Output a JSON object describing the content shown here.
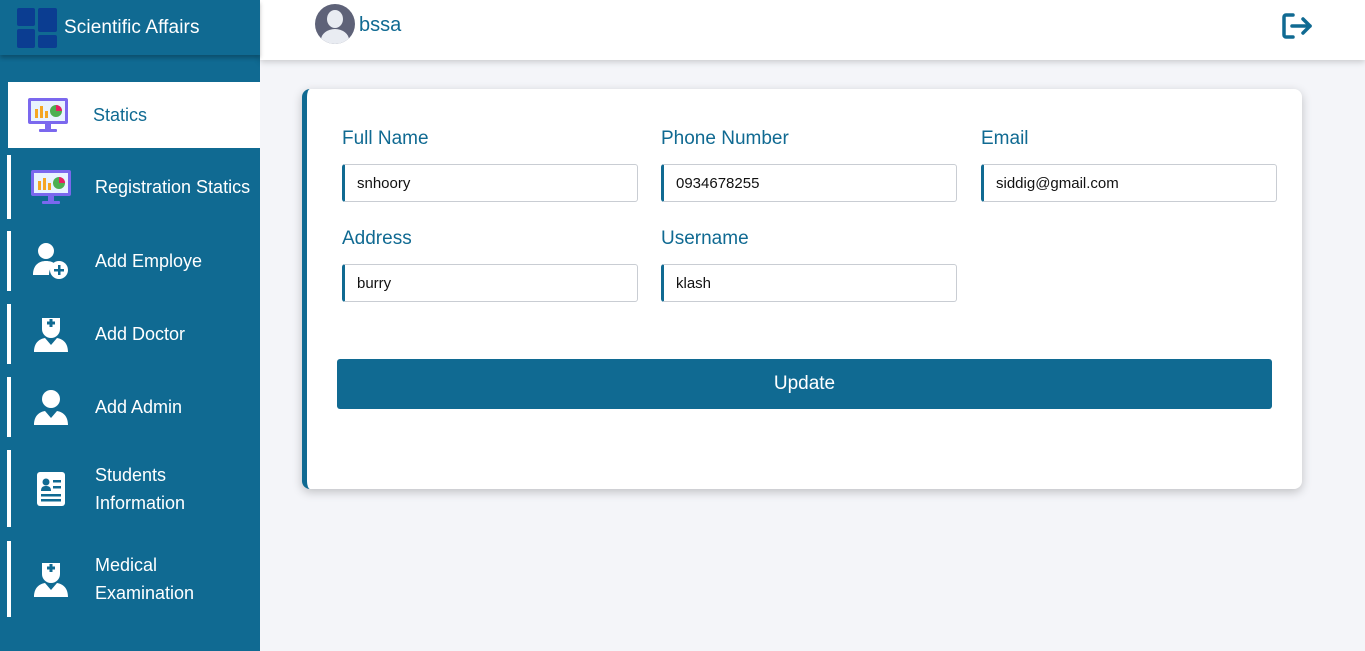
{
  "app": {
    "title": "Scientific Affairs"
  },
  "header": {
    "username": "bssa",
    "logout_icon": "logout-icon"
  },
  "sidebar": {
    "items": [
      {
        "label": "Statics",
        "icon": "monitor-chart-icon",
        "active": true
      },
      {
        "label": "Registration Statics",
        "icon": "monitor-chart-icon",
        "active": false
      },
      {
        "label": "Add Employe",
        "icon": "add-user-icon",
        "active": false
      },
      {
        "label": "Add Doctor",
        "icon": "doctor-icon",
        "active": false
      },
      {
        "label": "Add Admin",
        "icon": "admin-user-icon",
        "active": false
      },
      {
        "label": "Students Information",
        "icon": "id-card-icon",
        "active": false
      },
      {
        "label": "Medical Examination",
        "icon": "doctor-icon",
        "active": false
      }
    ]
  },
  "form": {
    "full_name": {
      "label": "Full Name",
      "value": "snhoory"
    },
    "phone": {
      "label": "Phone Number",
      "value": "0934678255"
    },
    "email": {
      "label": "Email",
      "value": "siddig@gmail.com"
    },
    "address": {
      "label": "Address",
      "value": "burry"
    },
    "username": {
      "label": "Username",
      "value": "klash"
    },
    "update_label": "Update"
  },
  "colors": {
    "primary": "#106a92",
    "background": "#f4f5f9",
    "logo": "#0b3d91"
  }
}
